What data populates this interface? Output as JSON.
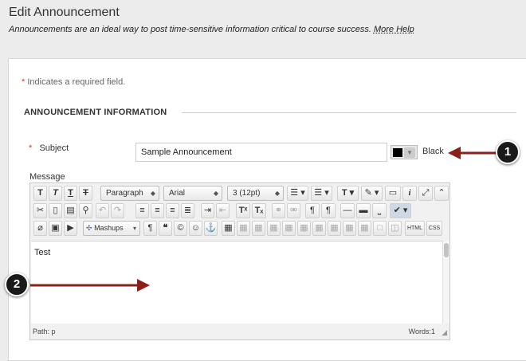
{
  "header": {
    "title": "Edit Announcement",
    "subtitle": "Announcements are an ideal way to post time-sensitive information critical to course success.",
    "more_help": "More Help"
  },
  "form": {
    "required_star": "*",
    "required_note": "Indicates a required field.",
    "section_title": "ANNOUNCEMENT INFORMATION",
    "subject_label": "Subject",
    "subject_value": "Sample Announcement",
    "subject_color": "Black",
    "message_label": "Message"
  },
  "editor": {
    "row1": {
      "bold": "T",
      "italic": "T",
      "underline": "T",
      "strike": "T",
      "paragraph": "Paragraph",
      "font": "Arial",
      "size": "3 (12pt)",
      "bullets": "☰",
      "numbers": "☰",
      "text_color": "T",
      "highlight": "✎",
      "preview": "▭",
      "info": "i",
      "fullscreen": "⤢",
      "collapse": "⌃"
    },
    "row3": {
      "mashups": "Mashups",
      "html": "HTML",
      "css": "CSS"
    },
    "content": "Test",
    "path": "Path: p",
    "words": "Words:1"
  },
  "callouts": {
    "one": "1",
    "two": "2"
  },
  "colors": {
    "arrow": "#8b1f1a",
    "required": "#c43c2e"
  }
}
